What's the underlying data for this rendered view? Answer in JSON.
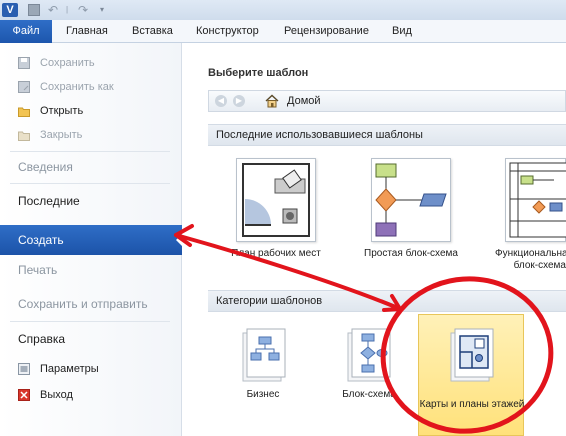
{
  "qat": {
    "app_letter": "V",
    "undo": "↶",
    "redo": "↷",
    "sep": "|",
    "dropdown": "▾"
  },
  "tabs": {
    "file": "Файл",
    "items": [
      "Главная",
      "Вставка",
      "Конструктор",
      "Рецензирование",
      "Вид"
    ]
  },
  "nav": {
    "save": "Сохранить",
    "save_as": "Сохранить как",
    "open": "Открыть",
    "close": "Закрыть",
    "info": "Сведения",
    "recent": "Последние",
    "new": "Создать",
    "print": "Печать",
    "save_send": "Сохранить и отправить",
    "help": "Справка",
    "options": "Параметры",
    "exit": "Выход"
  },
  "main": {
    "title": "Выберите шаблон",
    "home": "Домой",
    "recent_band": "Последние использовавшиеся шаблоны",
    "recent_templates": [
      {
        "label": "План рабочих мест"
      },
      {
        "label": "Простая блок-схема"
      },
      {
        "label": "Функциональная блок-схема"
      }
    ],
    "categories_band": "Категории шаблонов",
    "categories": [
      {
        "label": "Бизнес"
      },
      {
        "label": "Блок-схема"
      },
      {
        "label": "Карты и планы этажей"
      }
    ]
  },
  "colors": {
    "file_tab": "#2a63bd",
    "selected_nav": "#2a63bd",
    "annotation": "#e2141c",
    "category_highlight": "#ffe17a"
  }
}
